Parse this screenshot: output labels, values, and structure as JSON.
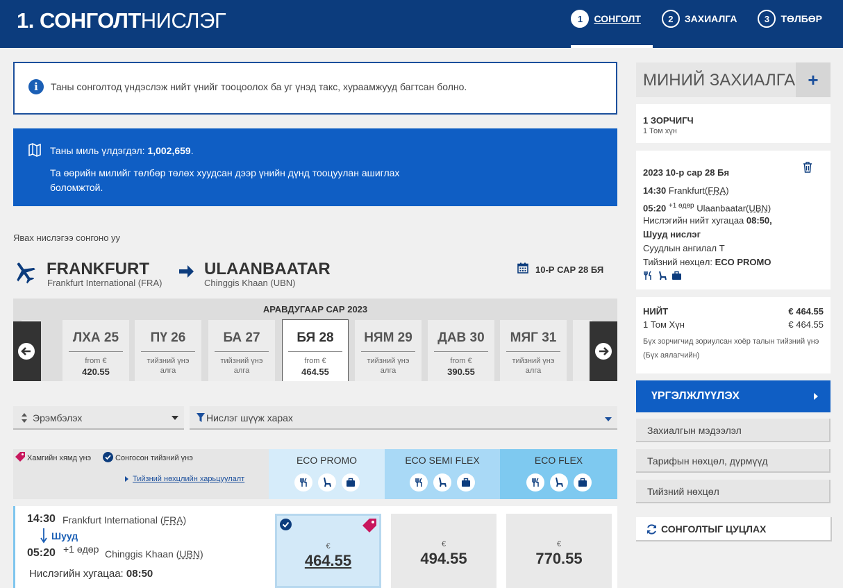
{
  "header": {
    "title_bold": "1. СОНГОЛТ",
    "title_rest": "НИСЛЭГ",
    "steps": [
      {
        "num": "1",
        "label": "СОНГОЛТ"
      },
      {
        "num": "2",
        "label": "ЗАХИАЛГА"
      },
      {
        "num": "3",
        "label": "ТӨЛБӨР"
      }
    ]
  },
  "info": {
    "text": "Таны сонголтод үндэслэж нийт үнийг тооцоолох ба уг үнэд такс, хураамжууд багтсан болно."
  },
  "miles": {
    "prefix": "Таны миль үлдэгдэл: ",
    "value": "1,002,659",
    "suffix": ".",
    "line2": "Та өөрийн милийг төлбөр төлөх хуудсан дээр үнийн дүнд тооцуулан ашиглах боломжтой."
  },
  "route": {
    "prompt": "Явах нислэгээ сонгоно уу",
    "from_city": "FRANKFURT",
    "from_airport": "Frankfurt International (FRA)",
    "to_city": "ULAANBAATAR",
    "to_airport": "Chinggis Khaan (UBN)",
    "date": "10-Р САР 28 БЯ"
  },
  "date_strip": {
    "month": "АРАВДУГААР САР 2023",
    "days": [
      {
        "day": "ЛХА 25",
        "line1": "from €",
        "line2": "420.55",
        "available": true
      },
      {
        "day": "ПҮ 26",
        "line1": "тийзний үнэ",
        "line2": "алга",
        "available": false
      },
      {
        "day": "БА 27",
        "line1": "тийзний үнэ",
        "line2": "алга",
        "available": false
      },
      {
        "day": "БЯ 28",
        "line1": "from €",
        "line2": "464.55",
        "available": true,
        "selected": true
      },
      {
        "day": "НЯМ 29",
        "line1": "тийзний үнэ",
        "line2": "алга",
        "available": false
      },
      {
        "day": "ДАВ 30",
        "line1": "from €",
        "line2": "390.55",
        "available": true
      },
      {
        "day": "МЯГ 31",
        "line1": "тийзний үнэ",
        "line2": "алга",
        "available": false
      }
    ]
  },
  "sort": {
    "label": "Эрэмбэлэх"
  },
  "filter": {
    "label": "Нислэг шүүж харах"
  },
  "legend": {
    "cheapest": "Хамгийн хямд үнэ",
    "selected": "Сонгосон тийзний үнэ",
    "compare": "Тийзний нөхцлийн харьцуулалт"
  },
  "fares": [
    {
      "name": "ECO PROMO",
      "color": "#d6ecfa"
    },
    {
      "name": "ECO SEMI FLEX",
      "color": "#a9d9f6"
    },
    {
      "name": "ECO FLEX",
      "color": "#7ec9f0"
    }
  ],
  "flight": {
    "dep_time": "14:30",
    "dep_place": "Frankfurt International",
    "dep_code": "FRA",
    "direct": "Шууд",
    "arr_time": "05:20",
    "arr_plus": "+1 өдөр",
    "arr_place": "Chinggis Khaan",
    "arr_code": "UBN",
    "duration_label": "Нислэгийн хугацаа: ",
    "duration": "08:50",
    "prices": [
      {
        "currency": "€",
        "amount": "464.55"
      },
      {
        "currency": "€",
        "amount": "494.55"
      },
      {
        "currency": "€",
        "amount": "770.55"
      }
    ]
  },
  "booking": {
    "title": "МИНИЙ ЗАХИАЛГА",
    "plus": "+",
    "passengers": "1 ЗОРЧИГЧ",
    "passengers_sub": "1 Том хүн",
    "date": "2023 10-р сар 28 Бя",
    "dep_time": "14:30",
    "dep_city": "Frankfurt",
    "dep_code": "FRA",
    "arr_time": "05:20",
    "arr_plus": "+1 өдөр",
    "arr_city": "Ulaanbaatar",
    "arr_code": "UBN",
    "dur_label": "Нислэгийн нийт хугацаа ",
    "dur_value": "08:50, Шууд нислэг",
    "cabin": "Суудлын ангилал T",
    "fare_label": "Тийзний нөхцөл: ",
    "fare_value": "ECO PROMO",
    "total_label": "НИЙТ",
    "total_value": "€ 464.55",
    "adult_label": "1 Том Хүн",
    "adult_value": "€ 464.55",
    "note": "Бүх зорчигчид зориулсан хоёр талын тийзний үнэ (Бүх аялагчийн)"
  },
  "actions": {
    "continue": "ҮРГЭЛЖЛҮҮЛЭХ",
    "booking_info": "Захиалгын мэдээлэл",
    "fare_rules": "Тарифын нөхцөл, дүрмүүд",
    "ticket_terms": "Тийзний нөхцөл",
    "reset": "СОНГОЛТЫГ ЦУЦЛАХ"
  },
  "colors": {
    "brand": "#0c3c7d",
    "accent": "#0f5ec4",
    "promo_tag": "#c8175d"
  }
}
